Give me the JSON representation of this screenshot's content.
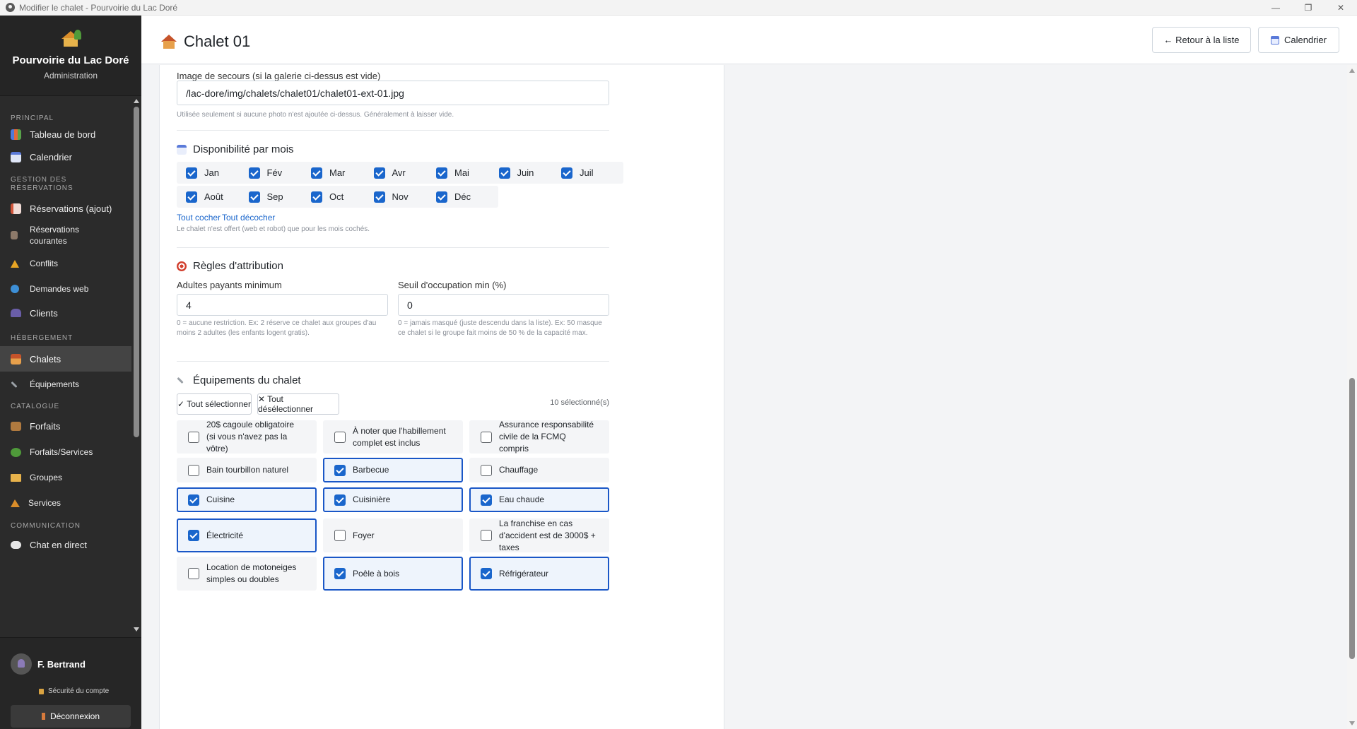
{
  "window": {
    "title": "Modifier le chalet - Pourvoirie du Lac Doré",
    "minimize": "—",
    "restore": "❐",
    "close": "✕"
  },
  "sidebar": {
    "brand_title": "Pourvoirie du Lac Doré",
    "brand_subtitle": "Administration",
    "sections": {
      "principal": "PRINCIPAL",
      "gestion": "GESTION DES RÉSERVATIONS",
      "hebergement": "HÉBERGEMENT",
      "catalogue": "CATALOGUE",
      "communication": "COMMUNICATION"
    },
    "items": {
      "dashboard": "Tableau de bord",
      "calendar": "Calendrier",
      "reservations_add": "Réservations (ajout)",
      "reservations_current": "Réservations courantes",
      "conflicts": "Conflits",
      "web_requests": "Demandes web",
      "clients": "Clients",
      "chalets": "Chalets",
      "equipments": "Équipements",
      "packages": "Forfaits",
      "packages_services": "Forfaits/Services",
      "groups": "Groupes",
      "services": "Services",
      "live_chat": "Chat en direct"
    },
    "user_name": "F. Bertrand",
    "account_security": "Sécurité du compte",
    "logout": "Déconnexion"
  },
  "header": {
    "title": "Chalet 01",
    "back_button": "← Retour à la liste",
    "calendar_button": "Calendrier"
  },
  "form": {
    "fallback_image": {
      "label": "Image de secours (si la galerie ci-dessus est vide)",
      "value": "/lac-dore/img/chalets/chalet01/chalet01-ext-01.jpg",
      "help": "Utilisée seulement si aucune photo n'est ajoutée ci-dessus. Généralement à laisser vide."
    },
    "availability": {
      "title": "Disponibilité par mois",
      "months": [
        {
          "label": "Jan",
          "checked": true
        },
        {
          "label": "Fév",
          "checked": true
        },
        {
          "label": "Mar",
          "checked": true
        },
        {
          "label": "Avr",
          "checked": true
        },
        {
          "label": "Mai",
          "checked": true
        },
        {
          "label": "Juin",
          "checked": true
        },
        {
          "label": "Juil",
          "checked": true
        },
        {
          "label": "Août",
          "checked": true
        },
        {
          "label": "Sep",
          "checked": true
        },
        {
          "label": "Oct",
          "checked": true
        },
        {
          "label": "Nov",
          "checked": true
        },
        {
          "label": "Déc",
          "checked": true
        }
      ],
      "check_all": "Tout cocher",
      "uncheck_all": "Tout décocher",
      "help": "Le chalet n'est offert (web et robot) que pour les mois cochés."
    },
    "rules": {
      "title": "Règles d'attribution",
      "min_adults_label": "Adultes payants minimum",
      "min_adults_value": "4",
      "min_adults_help": "0 = aucune restriction. Ex: 2 réserve ce chalet aux groupes d'au moins 2 adultes (les enfants logent gratis).",
      "occupancy_label": "Seuil d'occupation min (%)",
      "occupancy_value": "0",
      "occupancy_help": "0 = jamais masqué (juste descendu dans la liste). Ex: 50 masque ce chalet si le groupe fait moins de 50 % de la capacité max."
    },
    "equipments": {
      "title": "Équipements du chalet",
      "select_all": "✓ Tout sélectionner",
      "deselect_all": "✕ Tout désélectionner",
      "selected_count": "10 sélectionné(s)",
      "items": [
        {
          "label": "20$ cagoule obligatoire (si vous n'avez pas la vôtre)",
          "checked": false
        },
        {
          "label": "À noter que l'habillement complet est inclus",
          "checked": false
        },
        {
          "label": "Assurance responsabilité civile de la FCMQ compris",
          "checked": false
        },
        {
          "label": "Bain tourbillon naturel",
          "checked": false
        },
        {
          "label": "Barbecue",
          "checked": true
        },
        {
          "label": "Chauffage",
          "checked": false
        },
        {
          "label": "Cuisine",
          "checked": true
        },
        {
          "label": "Cuisinière",
          "checked": true
        },
        {
          "label": "Eau chaude",
          "checked": true
        },
        {
          "label": "Électricité",
          "checked": true
        },
        {
          "label": "Foyer",
          "checked": false
        },
        {
          "label": "La franchise en cas d'accident est de 3000$ + taxes",
          "checked": false
        },
        {
          "label": "Location de motoneiges simples ou doubles",
          "checked": false
        },
        {
          "label": "Poêle à bois",
          "checked": true
        },
        {
          "label": "Réfrigérateur",
          "checked": true
        }
      ]
    }
  },
  "colors": {
    "accent": "#1a66cc",
    "sidebar_bg": "#2b2b2b",
    "selected_border": "#1a57c7"
  }
}
